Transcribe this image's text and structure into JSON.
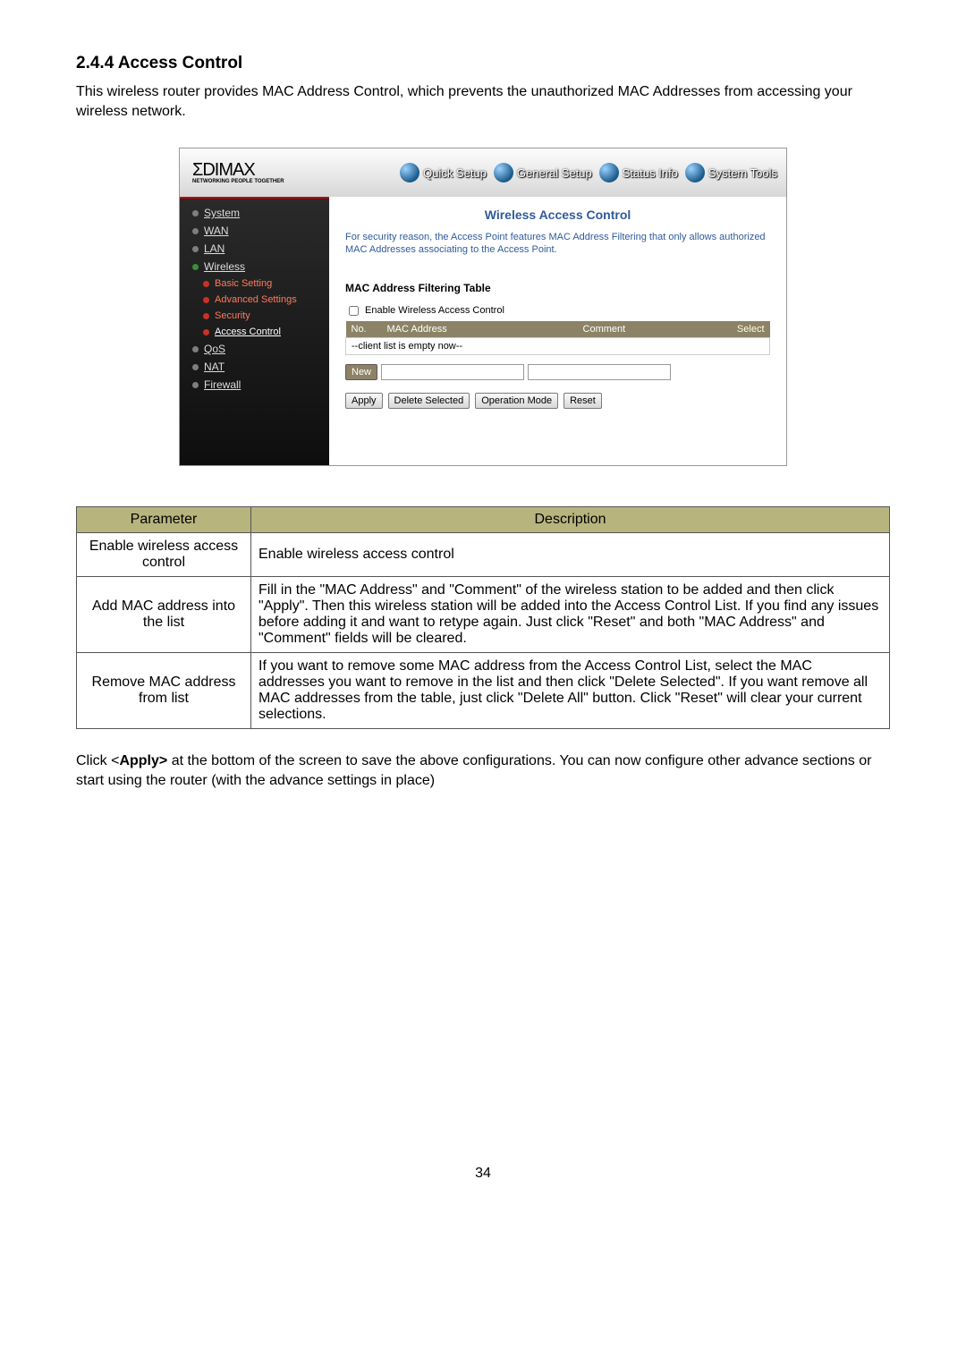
{
  "heading": "2.4.4 Access Control",
  "intro": "This wireless router provides MAC Address Control, which prevents the unauthorized MAC Addresses from accessing your wireless network.",
  "router": {
    "logo_text": "ΣDIMAX",
    "logo_tag": "NETWORKING PEOPLE TOGETHER",
    "topnav": {
      "quick": "Quick Setup",
      "general": "General Setup",
      "status": "Status Info",
      "tools": "System Tools"
    },
    "sidebar": {
      "system": "System",
      "wan": "WAN",
      "lan": "LAN",
      "wireless": "Wireless",
      "basic": "Basic Setting",
      "advanced": "Advanced Settings",
      "security": "Security",
      "access": "Access Control",
      "qos": "QoS",
      "nat": "NAT",
      "firewall": "Firewall"
    },
    "content": {
      "title": "Wireless Access Control",
      "desc": "For security reason, the Access Point features MAC Address Filtering that only allows authorized MAC Addresses associating to the Access Point.",
      "table_title": "MAC Address Filtering Table",
      "enable_label": "Enable Wireless Access Control",
      "th_no": "No.",
      "th_mac": "MAC Address",
      "th_comment": "Comment",
      "th_select": "Select",
      "empty_row": "--client list is empty now--",
      "new_btn": "New",
      "apply_btn": "Apply",
      "delete_btn": "Delete Selected",
      "opmode_btn": "Operation Mode",
      "reset_btn": "Reset"
    }
  },
  "param_table": {
    "head_param": "Parameter",
    "head_desc": "Description",
    "rows": [
      {
        "param": "Enable wireless access control",
        "desc": "Enable wireless access control"
      },
      {
        "param": "Add MAC address into the list",
        "desc": "Fill in the \"MAC Address\" and \"Comment\" of the wireless station to be added and then click \"Apply\". Then this wireless station will be added into the Access Control List. If you find any issues before adding it and want to retype again. Just click \"Reset\" and both \"MAC Address\" and \"Comment\" fields will be cleared."
      },
      {
        "param": "Remove MAC address from list",
        "desc": "If you want to remove some MAC address from the Access Control List, select the MAC addresses you want to remove in the list and then click \"Delete Selected\". If you want remove all MAC addresses from the table, just click \"Delete All\" button. Click \"Reset\" will clear your current selections."
      }
    ]
  },
  "bottom_before": "Click <",
  "bottom_bold": "Apply>",
  "bottom_after": " at the bottom of the screen to save the above configurations. You can now configure other advance sections or start using the router (with the advance settings in place)",
  "page_num": "34"
}
